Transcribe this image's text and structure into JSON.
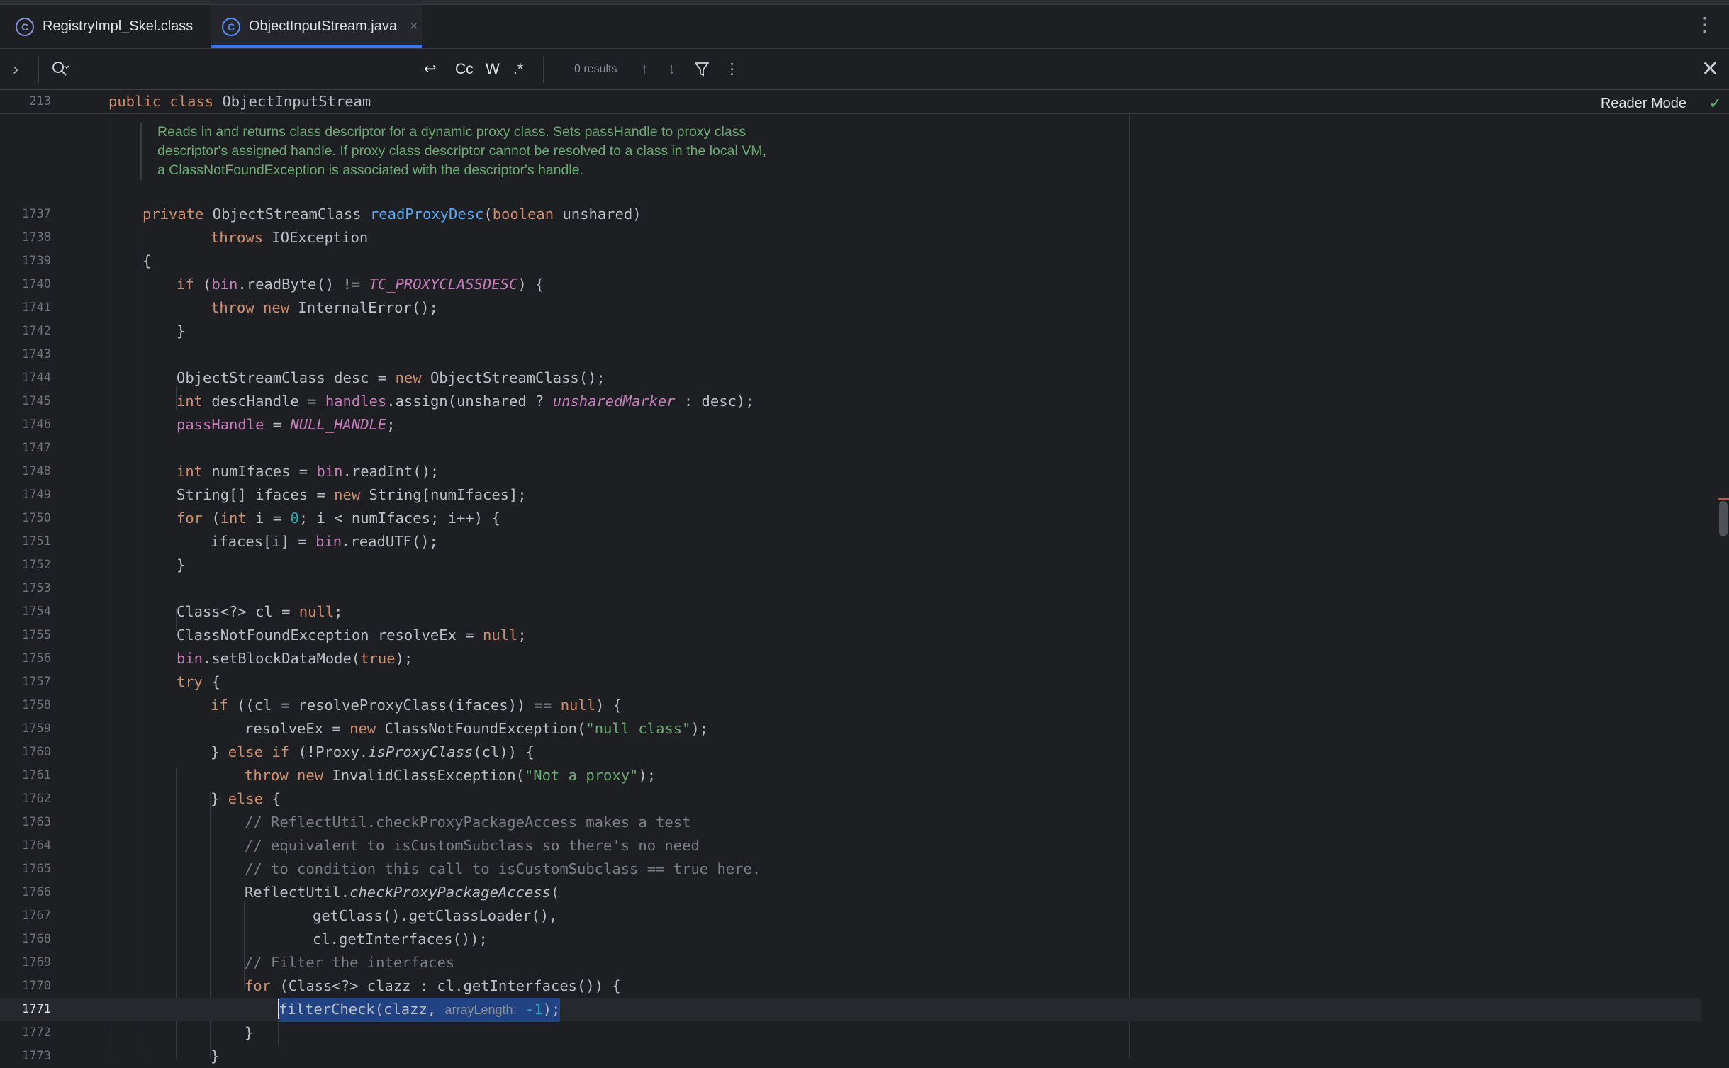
{
  "tabs": [
    {
      "label": "RegistryImpl_Skel.class",
      "icon": "class-file-icon"
    },
    {
      "label": "ObjectInputStream.java",
      "icon": "java-class-icon",
      "active": true,
      "close": "×"
    }
  ],
  "tabs_more": "⋮",
  "find": {
    "expand": "›",
    "search_icon": "⌕",
    "new_line": "↩",
    "match_case": "Cc",
    "words": "W",
    "regex": ".*",
    "results": "0 results",
    "prev": "↑",
    "next": "↓",
    "filter": "⛉",
    "more": "⋮",
    "close": "✕"
  },
  "editor": {
    "reader_mode": "Reader Mode",
    "check": "✓",
    "sticky": {
      "number": "213",
      "kw": "public class",
      "name": "ObjectInputStream"
    },
    "doc": [
      "Reads in and returns class descriptor for a dynamic proxy class. Sets passHandle to proxy class",
      "descriptor's assigned handle. If proxy class descriptor cannot be resolved to a class in the local VM,",
      "a ClassNotFoundException is associated with the descriptor's handle."
    ],
    "lines": {
      "n1737": "1737",
      "n1738": "1738",
      "n1739": "1739",
      "n1740": "1740",
      "n1741": "1741",
      "n1742": "1742",
      "n1743": "1743",
      "n1744": "1744",
      "n1745": "1745",
      "n1746": "1746",
      "n1747": "1747",
      "n1748": "1748",
      "n1749": "1749",
      "n1750": "1750",
      "n1751": "1751",
      "n1752": "1752",
      "n1753": "1753",
      "n1754": "1754",
      "n1755": "1755",
      "n1756": "1756",
      "n1757": "1757",
      "n1758": "1758",
      "n1759": "1759",
      "n1760": "1760",
      "n1761": "1761",
      "n1762": "1762",
      "n1763": "1763",
      "n1764": "1764",
      "n1765": "1765",
      "n1766": "1766",
      "n1767": "1767",
      "n1768": "1768",
      "n1769": "1769",
      "n1770": "1770",
      "n1771": "1771",
      "n1772": "1772",
      "n1773": "1773"
    },
    "code": {
      "l1737_kw": "private ",
      "l1737_t": "ObjectStreamClass ",
      "l1737_fn": "readProxyDesc",
      "l1737_p": "(",
      "l1737_kw2": "boolean ",
      "l1737_r": "unshared)",
      "l1738_kw": "throws ",
      "l1738_t": "IOException",
      "l1739": "{",
      "l1740_kw": "if ",
      "l1740_a": "(",
      "l1740_f": "bin",
      "l1740_b": ".readByte() != ",
      "l1740_c": "TC_PROXYCLASSDESC",
      "l1740_d": ") {",
      "l1741_kw": "throw new ",
      "l1741_t": "InternalError();",
      "l1742": "}",
      "l1744_a": "ObjectStreamClass desc = ",
      "l1744_kw": "new ",
      "l1744_b": "ObjectStreamClass();",
      "l1745_kw": "int ",
      "l1745_a": "descHandle = ",
      "l1745_f": "handles",
      "l1745_b": ".assign(unshared ? ",
      "l1745_c": "unsharedMarker",
      "l1745_d": " : desc);",
      "l1746_f": "passHandle",
      "l1746_a": " = ",
      "l1746_c": "NULL_HANDLE",
      "l1746_b": ";",
      "l1748_kw": "int ",
      "l1748_a": "numIfaces = ",
      "l1748_f": "bin",
      "l1748_b": ".readInt();",
      "l1749_a": "String[] ifaces = ",
      "l1749_kw": "new ",
      "l1749_b": "String[numIfaces];",
      "l1750_kw": "for ",
      "l1750_a": "(",
      "l1750_kw2": "int ",
      "l1750_b": "i = ",
      "l1750_n": "0",
      "l1750_c": "; i < numIfaces; i++) {",
      "l1751_a": "ifaces[i] = ",
      "l1751_f": "bin",
      "l1751_b": ".readUTF();",
      "l1752": "}",
      "l1754_a": "Class<?> cl = ",
      "l1754_kw": "null",
      "l1754_b": ";",
      "l1755_a": "ClassNotFoundException resolveEx = ",
      "l1755_kw": "null",
      "l1755_b": ";",
      "l1756_f": "bin",
      "l1756_a": ".setBlockDataMode(",
      "l1756_kw": "true",
      "l1756_b": ");",
      "l1757_kw": "try ",
      "l1757_a": "{",
      "l1758_kw": "if ",
      "l1758_a": "((cl = resolveProxyClass(ifaces)) == ",
      "l1758_kw2": "null",
      "l1758_b": ") {",
      "l1759_a": "resolveEx = ",
      "l1759_kw": "new ",
      "l1759_b": "ClassNotFoundException(",
      "l1759_s": "\"null class\"",
      "l1759_c": ");",
      "l1760_a": "} ",
      "l1760_kw": "else if ",
      "l1760_b": "(!Proxy.",
      "l1760_i": "isProxyClass",
      "l1760_c": "(cl)) {",
      "l1761_kw": "throw new ",
      "l1761_a": "InvalidClassException(",
      "l1761_s": "\"Not a proxy\"",
      "l1761_b": ");",
      "l1762_a": "} ",
      "l1762_kw": "else ",
      "l1762_b": "{",
      "l1763": "// ReflectUtil.checkProxyPackageAccess makes a test",
      "l1764": "// equivalent to isCustomSubclass so there's no need",
      "l1765": "// to condition this call to isCustomSubclass == true here.",
      "l1766_a": "ReflectUtil.",
      "l1766_i": "checkProxyPackageAccess",
      "l1766_b": "(",
      "l1767": "getClass().getClassLoader(),",
      "l1768": "cl.getInterfaces());",
      "l1769": "// Filter the interfaces",
      "l1770_kw": "for ",
      "l1770_a": "(Class<?> clazz : cl.getInterfaces()) {",
      "l1771_a": "filterCheck(clazz, ",
      "l1771_hint": "arrayLength:",
      "l1771_n": " -1",
      "l1771_b": ");",
      "l1772": "}",
      "l1773": "}"
    }
  }
}
